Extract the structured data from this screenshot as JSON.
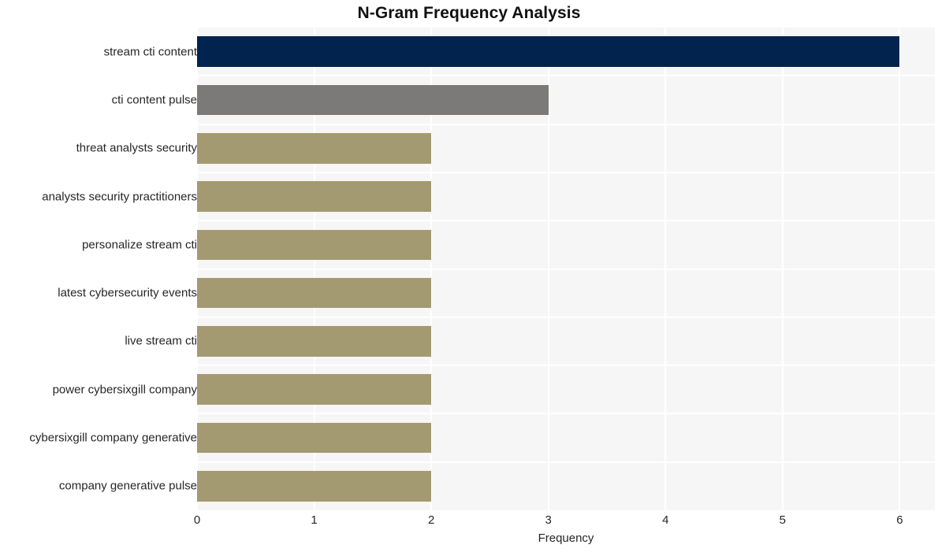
{
  "chart_data": {
    "type": "bar",
    "orientation": "horizontal",
    "title": "N-Gram Frequency Analysis",
    "xlabel": "Frequency",
    "ylabel": "",
    "xlim": [
      0,
      6.3
    ],
    "xticks": [
      0,
      1,
      2,
      3,
      4,
      5,
      6
    ],
    "xtick_labels": [
      "0",
      "1",
      "2",
      "3",
      "4",
      "5",
      "6"
    ],
    "grid": true,
    "legend": "none",
    "categories": [
      "stream cti content",
      "cti content pulse",
      "threat analysts security",
      "analysts security practitioners",
      "personalize stream cti",
      "latest cybersecurity events",
      "live stream cti",
      "power cybersixgill company",
      "cybersixgill company generative",
      "company generative pulse"
    ],
    "values": [
      6,
      3,
      2,
      2,
      2,
      2,
      2,
      2,
      2,
      2
    ],
    "bar_colors": [
      "#03234f",
      "#7b7a78",
      "#a39a72",
      "#a39a72",
      "#a39a72",
      "#a39a72",
      "#a39a72",
      "#a39a72",
      "#a39a72",
      "#a39a72"
    ],
    "plot_background": "#f6f6f6",
    "grid_color": "#ffffff",
    "figure_background": "#ffffff",
    "text_color": "#262626",
    "title_color": "#111111"
  }
}
